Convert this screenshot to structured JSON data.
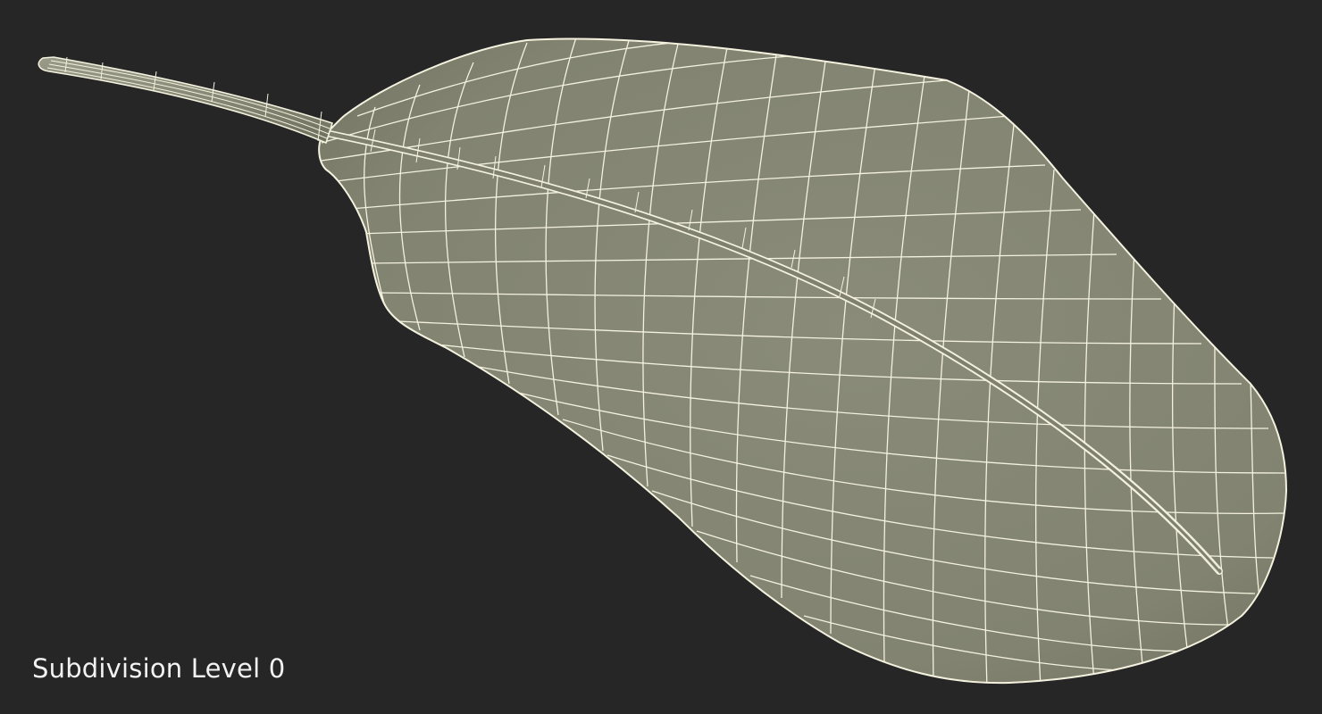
{
  "caption": "Subdivision Level 0",
  "colors": {
    "background": "#262626",
    "surface": "#848573",
    "surface_shadow": "#6e6f60",
    "wire": "#f4f2df",
    "caption_text": "#f2f2f2"
  }
}
